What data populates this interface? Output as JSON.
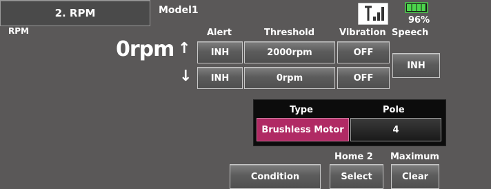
{
  "header": {
    "page_title": "2. RPM",
    "model_name": "Model1",
    "section_label": "RPM",
    "battery_percent": "96%",
    "battery_level": 0.96
  },
  "columns": {
    "alert": "Alert",
    "threshold": "Threshold",
    "vibration": "Vibration",
    "speech": "Speech"
  },
  "rpm_display": {
    "value": "0rpm",
    "up_arrow": "↑",
    "down_arrow": "↓"
  },
  "rows": [
    {
      "direction": "up",
      "alert": "INH",
      "threshold": "2000rpm",
      "vibration": "OFF"
    },
    {
      "direction": "down",
      "alert": "INH",
      "threshold": "0rpm",
      "vibration": "OFF"
    }
  ],
  "speech_value": "INH",
  "motor": {
    "type_header": "Type",
    "pole_header": "Pole",
    "type_value": "Brushless Motor",
    "pole_value": "4"
  },
  "bottom": {
    "condition_label": "Condition",
    "home_label": "Home 2",
    "select_label": "Select",
    "maximum_label": "Maximum",
    "clear_label": "Clear"
  },
  "colors": {
    "background": "#5a5858",
    "type_highlight": "#b02a64",
    "battery_green": "#4cd64c"
  }
}
